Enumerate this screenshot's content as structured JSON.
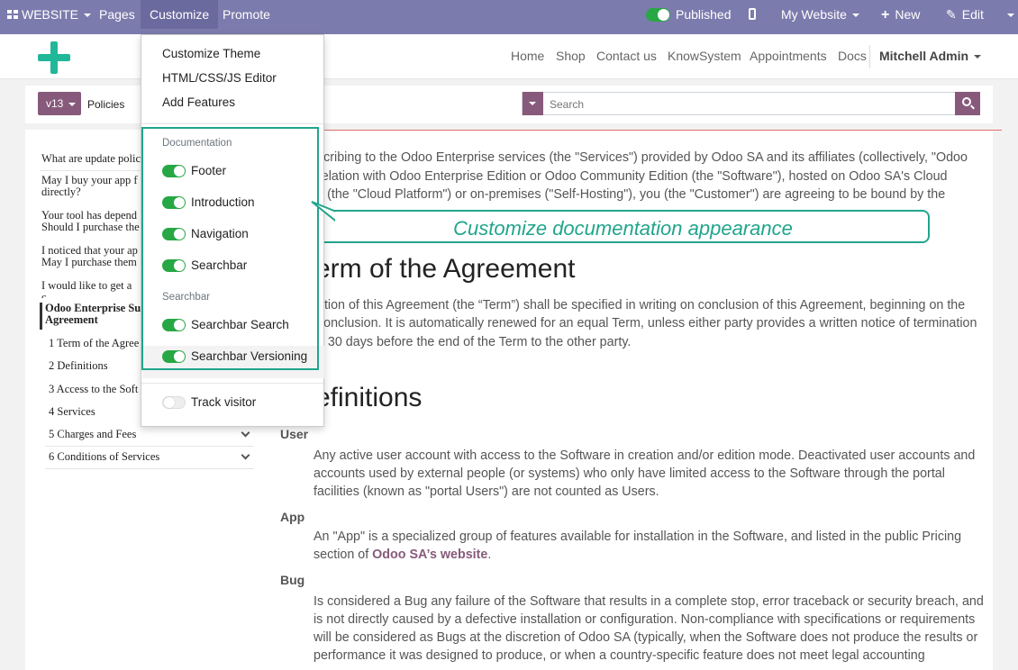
{
  "topbar": {
    "apps_label": "WEBSITE",
    "pages": "Pages",
    "customize": "Customize",
    "promote": "Promote",
    "published": "Published",
    "my_website": "My Website",
    "new": "New",
    "edit": "Edit"
  },
  "header": {
    "nav": [
      "Home",
      "Shop",
      "Contact us",
      "KnowSystem",
      "Appointments",
      "Docs"
    ],
    "user": "Mitchell Admin"
  },
  "searchbar": {
    "version": "v13",
    "breadcrumb": "Policies",
    "placeholder": "Search"
  },
  "dropdown": {
    "items": [
      "Customize Theme",
      "HTML/CSS/JS Editor",
      "Add Features"
    ],
    "documentation_header": "Documentation",
    "documentation_toggles": [
      "Footer",
      "Introduction",
      "Navigation",
      "Searchbar"
    ],
    "searchbar_header": "Searchbar",
    "searchbar_toggles": [
      "Searchbar Search",
      "Searchbar Versioning"
    ],
    "track_visitor": "Track visitor"
  },
  "callout": "Customize documentation appearance",
  "sidebar": {
    "items": [
      "What are update polic",
      "May I buy your app f directly?",
      "Your tool has depend Should I purchase the",
      "I noticed that your ap May I purchase them",
      "I would like to get a c"
    ],
    "active": "Odoo Enterprise Su Agreement",
    "subitems": [
      "1 Term of the Agree",
      "2 Definitions",
      "3 Access to the Soft",
      "4 Services",
      "5 Charges and Fees",
      "6 Conditions of Services"
    ]
  },
  "doc": {
    "intro": [
      "scribing to the Odoo Enterprise services (the \"Services\") provided by Odoo SA and its affiliates (collectively, \"Odoo",
      "relation with Odoo Enterprise Edition or Odoo Community Edition (the \"Software\"), hosted on Odoo SA's Cloud",
      "s (the \"Cloud Platform\") or on-premises (\"Self-Hosting\"), you (the \"Customer\") are agreeing to be bound by the"
    ],
    "h_term": "erm of the Agreement",
    "term_text": [
      "ation of this Agreement (the “Term”) shall be specified in writing on conclusion of this Agreement, beginning on the",
      "conclusion. It is automatically renewed for an equal Term, unless either party provides a written notice of termination",
      "n 30 days before the end of the Term to the other party."
    ],
    "h_definitions": "efinitions",
    "user_term": "User",
    "user_text": [
      "Any active user account with access to the Software in creation and/or edition mode. Deactivated user accounts and",
      "accounts used by external people (or systems) who only have limited access to the Software through the portal",
      "facilities (known as \"portal Users\") are not counted as Users."
    ],
    "app_term": "App",
    "app_text_1": "An \"App\" is a specialized group of features available for installation in the Software, and listed in the public Pricing",
    "app_text_2_pre": "section of ",
    "app_link": "Odoo SA’s website",
    "app_text_2_post": ".",
    "bug_term": "Bug",
    "bug_text": [
      "Is considered a Bug any failure of the Software that results in a complete stop, error traceback or security breach, and",
      "is not directly caused by a defective installation or configuration. Non-compliance with specifications or requirements",
      "will be considered as Bugs at the discretion of Odoo SA (typically, when the Software does not produce the results or",
      "performance it was designed to produce, or when a country-specific feature does not meet legal accounting"
    ]
  }
}
